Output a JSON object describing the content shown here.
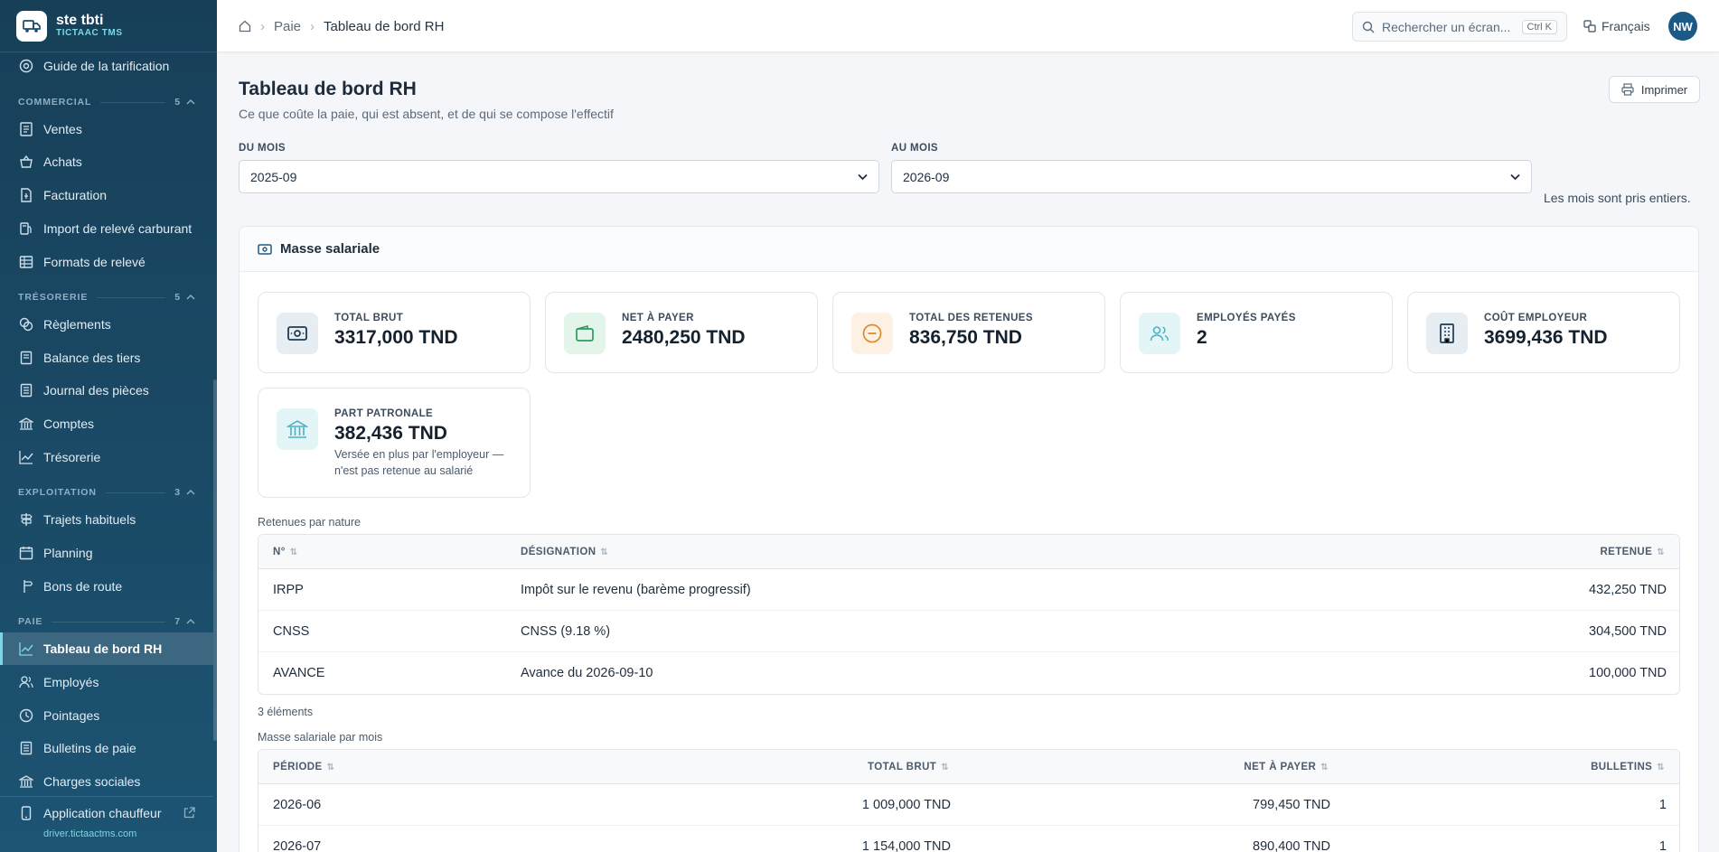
{
  "brand": {
    "name": "ste tbti",
    "sub": "TICTAAC TMS"
  },
  "sidebar": {
    "top_item": "Guide de la tarification",
    "sections": [
      {
        "title": "COMMERCIAL",
        "count": "5"
      },
      {
        "title": "TRÉSORERIE",
        "count": "5"
      },
      {
        "title": "EXPLOITATION",
        "count": "3"
      },
      {
        "title": "PAIE",
        "count": "7"
      }
    ],
    "commercial": [
      "Ventes",
      "Achats",
      "Facturation",
      "Import de relevé carburant",
      "Formats de relevé"
    ],
    "tresorerie": [
      "Règlements",
      "Balance des tiers",
      "Journal des pièces",
      "Comptes",
      "Trésorerie"
    ],
    "exploitation": [
      "Trajets habituels",
      "Planning",
      "Bons de route"
    ],
    "paie": [
      "Tableau de bord RH",
      "Employés",
      "Pointages",
      "Bulletins de paie",
      "Charges sociales"
    ],
    "driver_app": "Application chauffeur",
    "driver_url": "driver.tictaactms.com"
  },
  "topbar": {
    "breadcrumb": [
      "Paie",
      "Tableau de bord RH"
    ],
    "search_placeholder": "Rechercher un écran...",
    "search_shortcut": "Ctrl K",
    "language": "Français",
    "avatar": "NW"
  },
  "page": {
    "title": "Tableau de bord RH",
    "subtitle": "Ce que coûte la paie, qui est absent, et de qui se compose l'effectif",
    "print_label": "Imprimer",
    "from_label": "DU MOIS",
    "from_value": "2025-09",
    "to_label": "AU MOIS",
    "to_value": "2026-09",
    "hint": "Les mois sont pris entiers."
  },
  "masse": {
    "title": "Masse salariale",
    "cards": [
      {
        "label": "TOTAL BRUT",
        "value": "3317,000 TND"
      },
      {
        "label": "NET À PAYER",
        "value": "2480,250 TND"
      },
      {
        "label": "TOTAL DES RETENUES",
        "value": "836,750 TND"
      },
      {
        "label": "EMPLOYÉS PAYÉS",
        "value": "2"
      },
      {
        "label": "COÛT EMPLOYEUR",
        "value": "3699,436 TND"
      },
      {
        "label": "PART PATRONALE",
        "value": "382,436 TND",
        "note": "Versée en plus par l'employeur — n'est pas retenue au salarié"
      }
    ]
  },
  "retenues": {
    "caption": "Retenues par nature",
    "headers": [
      "N°",
      "DÉSIGNATION",
      "RETENUE"
    ],
    "rows": [
      {
        "code": "IRPP",
        "label": "Impôt sur le revenu (barème progressif)",
        "amount": "432,250 TND"
      },
      {
        "code": "CNSS",
        "label": "CNSS (9.18 %)",
        "amount": "304,500 TND"
      },
      {
        "code": "AVANCE",
        "label": "Avance du 2026-09-10",
        "amount": "100,000 TND"
      }
    ],
    "count": "3 éléments"
  },
  "mensuel": {
    "caption": "Masse salariale par mois",
    "headers": [
      "PÉRIODE",
      "TOTAL BRUT",
      "NET À PAYER",
      "BULLETINS"
    ],
    "rows": [
      {
        "period": "2026-06",
        "brut": "1 009,000 TND",
        "net": "799,450 TND",
        "bulletins": "1"
      },
      {
        "period": "2026-07",
        "brut": "1 154,000 TND",
        "net": "890,400 TND",
        "bulletins": "1"
      }
    ]
  }
}
